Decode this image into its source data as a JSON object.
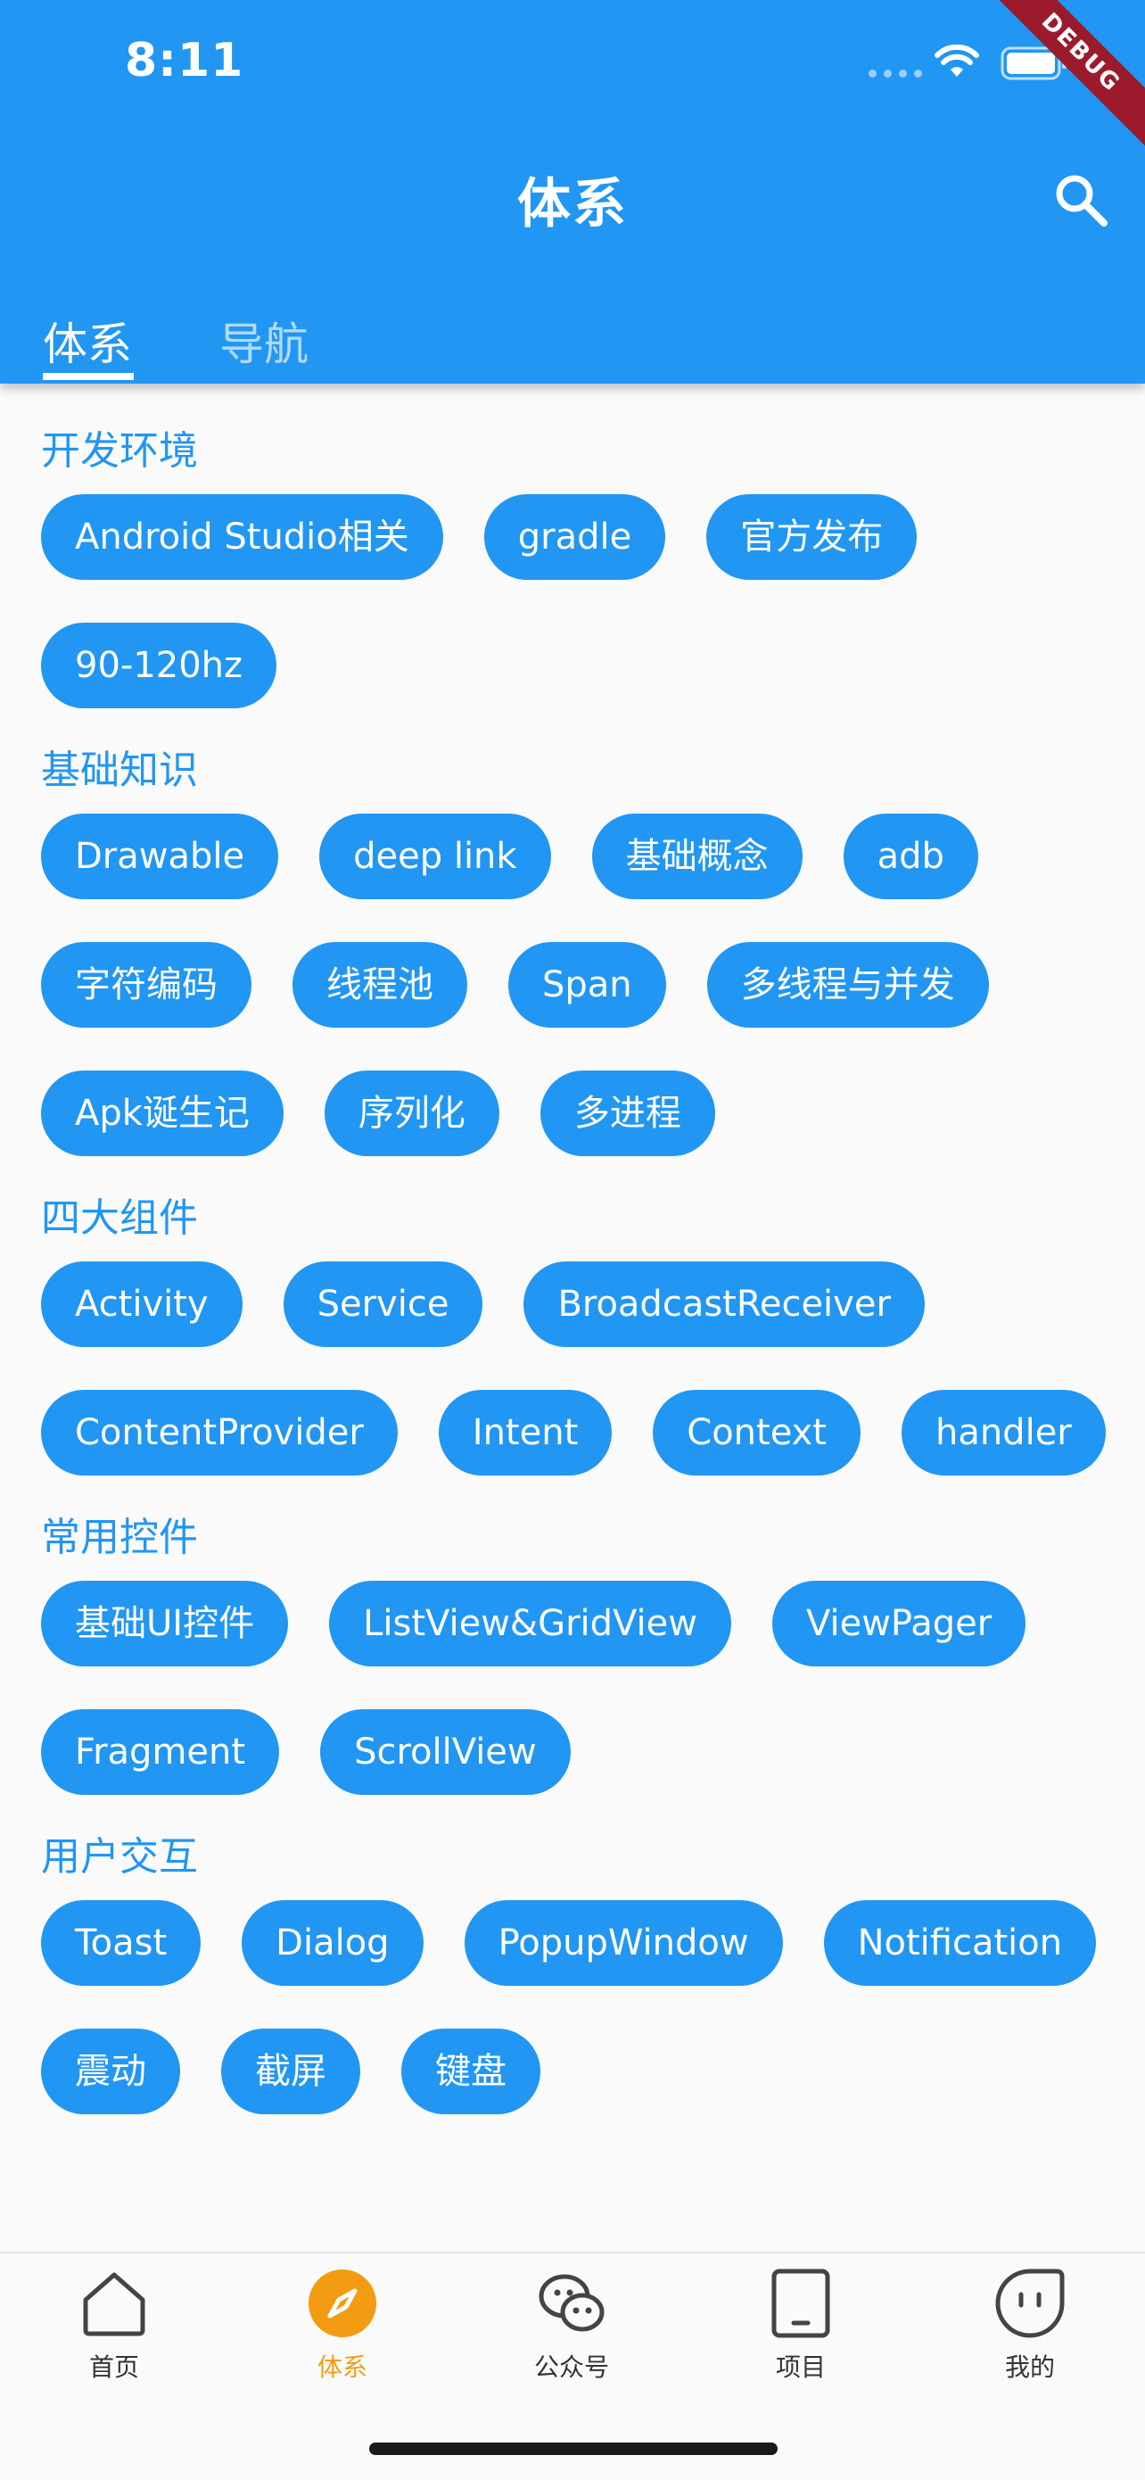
{
  "status_bar": {
    "time": "8:11"
  },
  "debug_banner": "DEBUG",
  "app_bar": {
    "title": "体系",
    "search_icon": "search-icon"
  },
  "tabs": [
    {
      "label": "体系",
      "active": true
    },
    {
      "label": "导航",
      "active": false
    }
  ],
  "sections": [
    {
      "title": "开发环境",
      "chips": [
        "Android Studio相关",
        "gradle",
        "官方发布",
        "90-120hz"
      ]
    },
    {
      "title": "基础知识",
      "chips": [
        "Drawable",
        "deep link",
        "基础概念",
        "adb",
        "字符编码",
        "线程池",
        "Span",
        "多线程与并发",
        "Apk诞生记",
        "序列化",
        "多进程"
      ]
    },
    {
      "title": "四大组件",
      "chips": [
        "Activity",
        "Service",
        "BroadcastReceiver",
        "ContentProvider",
        "Intent",
        "Context",
        "handler"
      ]
    },
    {
      "title": "常用控件",
      "chips": [
        "基础UI控件",
        "ListView&GridView",
        "ViewPager",
        "Fragment",
        "ScrollView"
      ]
    },
    {
      "title": "用户交互",
      "chips": [
        "Toast",
        "Dialog",
        "PopupWindow",
        "Notification",
        "震动",
        "截屏",
        "键盘"
      ]
    }
  ],
  "bottom_nav": [
    {
      "label": "首页",
      "icon": "home-icon",
      "active": false
    },
    {
      "label": "体系",
      "icon": "compass-icon",
      "active": true
    },
    {
      "label": "公众号",
      "icon": "wechat-icon",
      "active": false
    },
    {
      "label": "项目",
      "icon": "tablet-icon",
      "active": false
    },
    {
      "label": "我的",
      "icon": "smiley-icon",
      "active": false
    }
  ],
  "colors": {
    "primary": "#2196f3",
    "accent": "#f39c12",
    "debug": "#9b1b2c"
  }
}
